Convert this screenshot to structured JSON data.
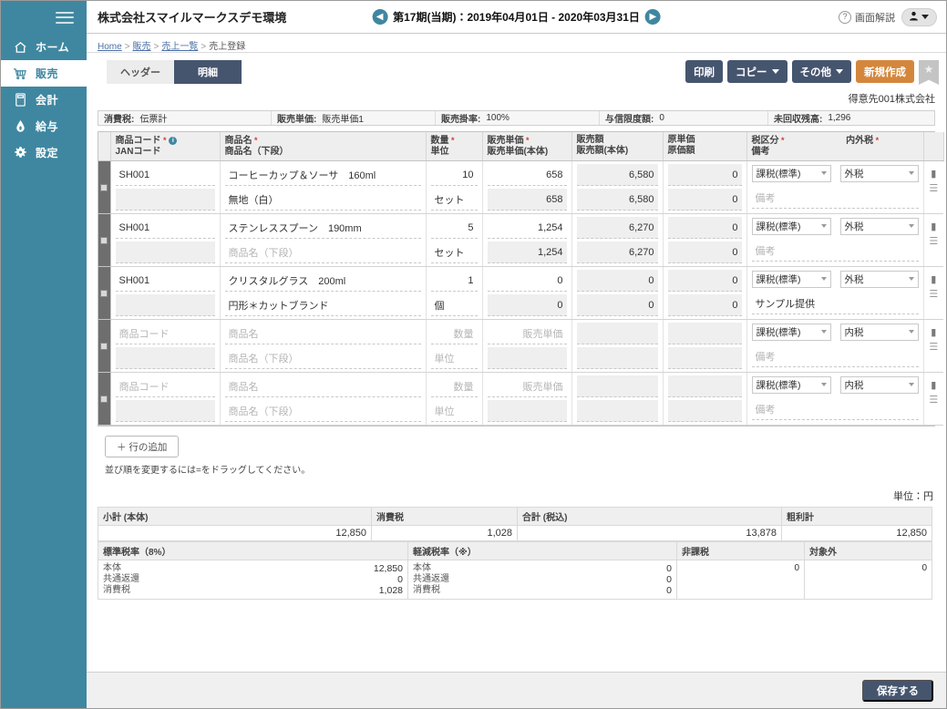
{
  "sidebar": {
    "menu_icon": "hamburger-icon",
    "items": [
      {
        "label": "ホーム",
        "icon": "home-icon",
        "active": false
      },
      {
        "label": "販売",
        "icon": "cart-icon",
        "active": true
      },
      {
        "label": "会計",
        "icon": "calculator-icon",
        "active": false
      },
      {
        "label": "給与",
        "icon": "payroll-icon",
        "active": false
      },
      {
        "label": "設定",
        "icon": "gear-icon",
        "active": false
      }
    ]
  },
  "topbar": {
    "company": "株式会社スマイルマークスデモ環境",
    "period": "第17期(当期)：2019年04月01日 - 2020年03月31日",
    "prev_icon": "chevron-left-icon",
    "next_icon": "chevron-right-icon",
    "help_label": "画面解説",
    "help_icon": "question-icon",
    "user_icon": "user-icon"
  },
  "breadcrumb": {
    "items": [
      "Home",
      "販売",
      "売上一覧",
      "売上登録"
    ],
    "separator": ">"
  },
  "tabs": [
    {
      "label": "ヘッダー",
      "active": false
    },
    {
      "label": "明細",
      "active": true
    }
  ],
  "toolbar": {
    "print_label": "印刷",
    "copy_label": "コピー",
    "other_label": "その他",
    "new_label": "新規作成",
    "star_icon": "star-icon"
  },
  "customer_name": "得意先001株式会社",
  "infobar": [
    {
      "label": "消費税:",
      "value": "伝票計"
    },
    {
      "label": "販売単価:",
      "value": "販売単価1"
    },
    {
      "label": "販売掛率:",
      "value": "100%"
    },
    {
      "label": "与信限度額:",
      "value": "0"
    },
    {
      "label": "未回収残高:",
      "value": "1,296"
    }
  ],
  "grid": {
    "headers": [
      {
        "top": "商品コード",
        "bottom": "JANコード",
        "required": true,
        "info": true,
        "align": "left"
      },
      {
        "top": "商品名",
        "bottom": "商品名（下段）",
        "required": true,
        "info": false,
        "align": "left"
      },
      {
        "top": "数量",
        "bottom": "単位",
        "required": true,
        "info": false,
        "align": "left"
      },
      {
        "top": "販売単価",
        "bottom": "販売単価(本体)",
        "required": true,
        "info": false,
        "align": "left"
      },
      {
        "top": "販売額",
        "bottom": "販売額(本体)",
        "required": false,
        "info": false,
        "align": "left"
      },
      {
        "top": "原単価",
        "bottom": "原価額",
        "required": false,
        "info": false,
        "align": "left"
      },
      {
        "top": "税区分",
        "bottom": "備考",
        "required": true,
        "info": false,
        "align": "left"
      },
      {
        "top": "内外税",
        "bottom": "",
        "required": true,
        "info": false,
        "align": "left"
      }
    ],
    "rows": [
      {
        "empty": false,
        "code": "SH001",
        "jan": "",
        "name": "コーヒーカップ＆ソーサ　160ml",
        "name2": "無地（白）",
        "qty": "10",
        "unit": "セット",
        "price": "658",
        "price_body": "658",
        "amount": "6,580",
        "amount_body": "6,580",
        "cost_unit": "0",
        "cost_amount": "0",
        "tax_class": "課税(標準)",
        "remark": "",
        "tax_type": "外税"
      },
      {
        "empty": false,
        "code": "SH001",
        "jan": "",
        "name": "ステンレススプーン　190mm",
        "name2": "",
        "qty": "5",
        "unit": "セット",
        "price": "1,254",
        "price_body": "1,254",
        "amount": "6,270",
        "amount_body": "6,270",
        "cost_unit": "0",
        "cost_amount": "0",
        "tax_class": "課税(標準)",
        "remark": "",
        "tax_type": "外税"
      },
      {
        "empty": false,
        "code": "SH001",
        "jan": "",
        "name": "クリスタルグラス　200ml",
        "name2": "円形＊カットブランド",
        "qty": "1",
        "unit": "個",
        "price": "0",
        "price_body": "0",
        "amount": "0",
        "amount_body": "0",
        "cost_unit": "0",
        "cost_amount": "0",
        "tax_class": "課税(標準)",
        "remark": "サンプル提供",
        "tax_type": "外税"
      },
      {
        "empty": true,
        "code": "",
        "jan": "",
        "name": "",
        "name2": "",
        "qty": "",
        "unit": "",
        "price": "",
        "price_body": "",
        "amount": "",
        "amount_body": "",
        "cost_unit": "",
        "cost_amount": "",
        "tax_class": "課税(標準)",
        "remark": "",
        "tax_type": "内税"
      },
      {
        "empty": true,
        "code": "",
        "jan": "",
        "name": "",
        "name2": "",
        "qty": "",
        "unit": "",
        "price": "",
        "price_body": "",
        "amount": "",
        "amount_body": "",
        "cost_unit": "",
        "cost_amount": "",
        "tax_class": "課税(標準)",
        "remark": "",
        "tax_type": "内税"
      }
    ],
    "placeholders": {
      "code": "商品コード",
      "name": "商品名",
      "name2": "商品名（下段）",
      "qty": "数量",
      "unit": "単位",
      "price": "販売単価",
      "remark": "備考"
    },
    "row_icons": {
      "note": "note-icon",
      "drag": "drag-handle-icon",
      "grip": "row-grip-icon"
    }
  },
  "add_row": {
    "label": "＋ 行の追加",
    "hint": "並び順を変更するには=をドラッグしてください。"
  },
  "unit_note": "単位：円",
  "totals": {
    "headers": [
      "小計 (本体)",
      "消費税",
      "合計 (税込)",
      "粗利計"
    ],
    "values": [
      "12,850",
      "1,028",
      "13,878",
      "12,850"
    ]
  },
  "tax_breakdown": {
    "columns": [
      {
        "header": "標準税率（8%）",
        "rows": [
          {
            "label": "本体",
            "value": "12,850"
          },
          {
            "label": "共通返還",
            "value": "0"
          },
          {
            "label": "消費税",
            "value": "1,028"
          }
        ]
      },
      {
        "header": "軽減税率（※）",
        "rows": [
          {
            "label": "本体",
            "value": "0"
          },
          {
            "label": "共通返還",
            "value": "0"
          },
          {
            "label": "消費税",
            "value": "0"
          }
        ]
      },
      {
        "header": "非課税",
        "single_value": "0"
      },
      {
        "header": "対象外",
        "single_value": "0"
      }
    ]
  },
  "footer": {
    "save_label": "保存する"
  },
  "colors": {
    "sidebar": "#3f87a0",
    "primary_button": "#46556e",
    "accent_orange": "#d4873c",
    "required_mark": "#d23b2e"
  }
}
